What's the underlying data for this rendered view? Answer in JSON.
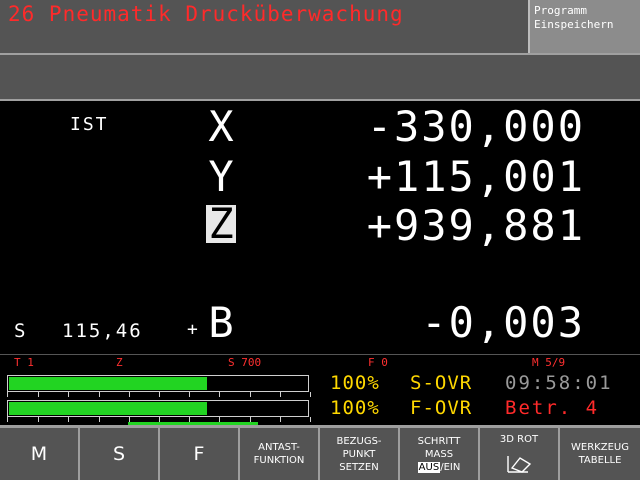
{
  "header": {
    "title": "26 Pneumatik Drucküberwachung",
    "mode_line1": "Programm",
    "mode_line2": "Einspeichern"
  },
  "position": {
    "label": "IST",
    "axes": [
      {
        "axis": "X",
        "value": "-330,000"
      },
      {
        "axis": "Y",
        "value": "+115,001"
      },
      {
        "axis": "Z",
        "value": "+939,881"
      },
      {
        "axis": "B",
        "value": "-0,003"
      }
    ],
    "active_axis": "Z",
    "spindle_label": "S",
    "spindle_value": "115,46",
    "marker": "+"
  },
  "status": {
    "tool": "T 1",
    "axis": "Z",
    "speed": "S 700",
    "feed": "F 0",
    "mfunc": "M 5/9"
  },
  "override": {
    "s_ovr_percent": "100%",
    "s_ovr_label": "S-OVR",
    "s_fill": 0.66,
    "f_ovr_percent": "100%",
    "f_ovr_label": "F-OVR",
    "f_fill": 0.66,
    "clock": "09:58:01",
    "betr": "Betr. 4"
  },
  "softkeys": {
    "m": "M",
    "s": "S",
    "f": "F",
    "antast_1": "ANTAST-",
    "antast_2": "FUNKTION",
    "bezug_1": "BEZUGS-",
    "bezug_2": "PUNKT",
    "bezug_3": "SETZEN",
    "schritt_1": "SCHRITT",
    "schritt_2": "MASS",
    "schritt_aus": "AUS",
    "schritt_sep": "/",
    "schritt_ein": "EIN",
    "rot_1": "3D ROT",
    "werk_1": "WERKZEUG",
    "werk_2": "TABELLE"
  },
  "colors": {
    "header_bg": "#545454",
    "title": "#ff2a2a",
    "override": "#ffd800",
    "bar_fill": "#22d422",
    "clock": "#9a9a9a"
  }
}
